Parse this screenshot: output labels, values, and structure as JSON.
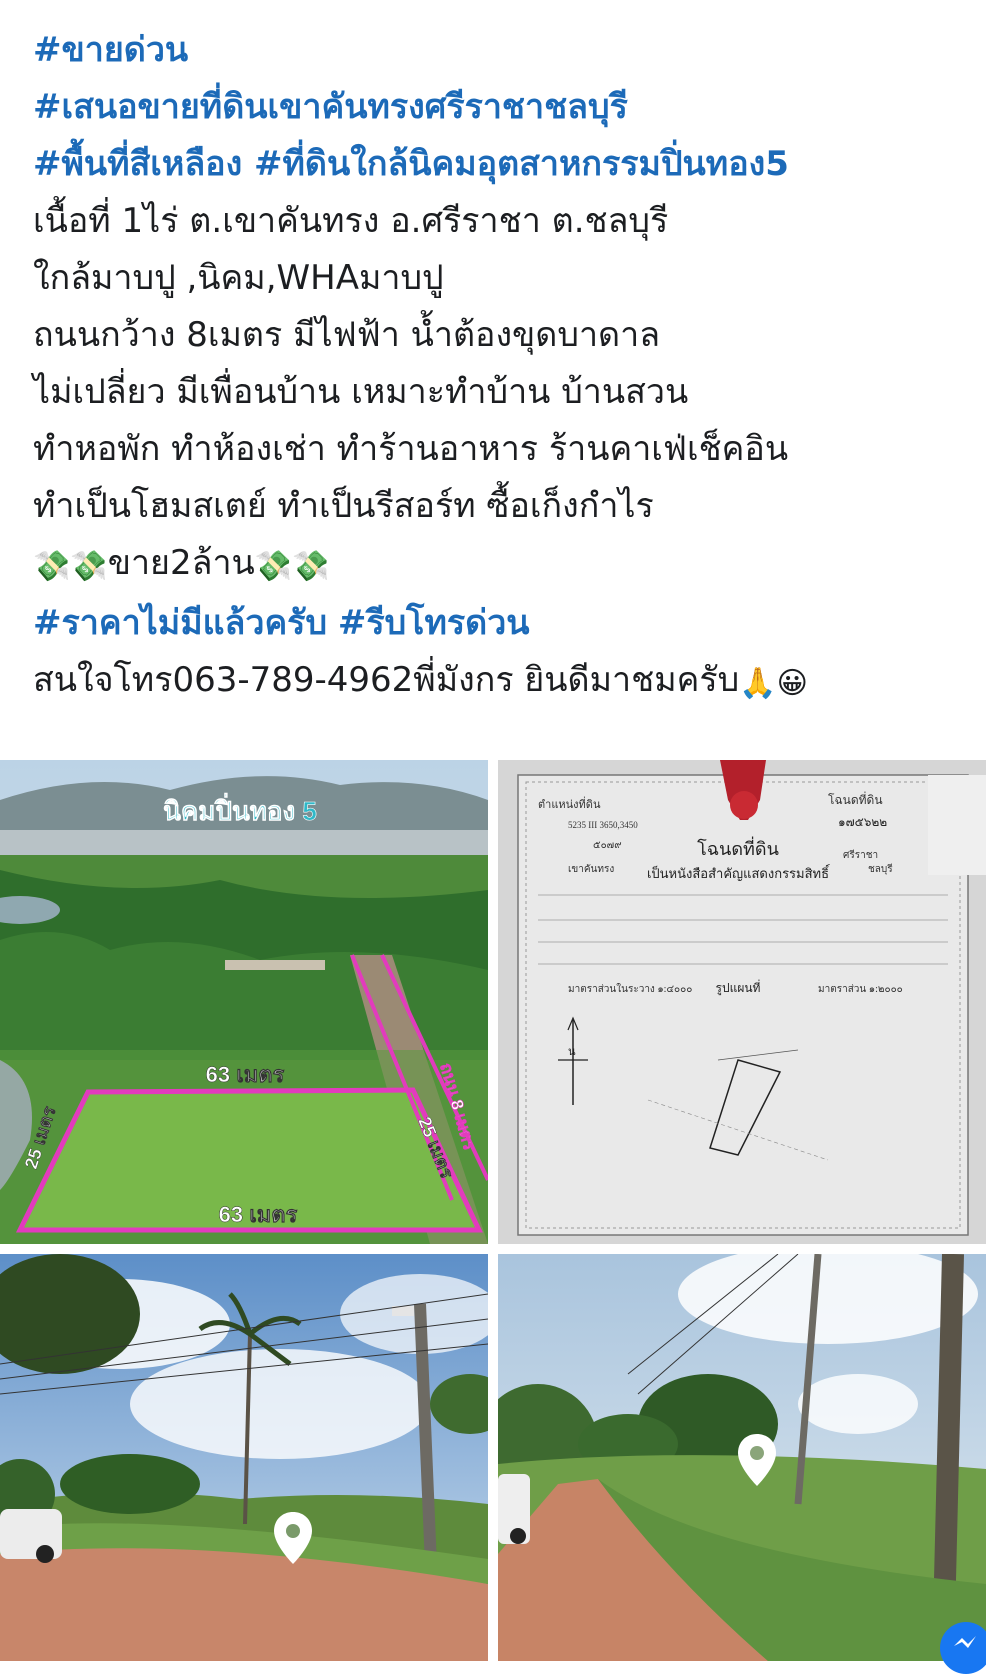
{
  "post": {
    "lines": [
      {
        "kind": "tag",
        "text": "#ขายด่วน"
      },
      {
        "kind": "tag",
        "text": "#เสนอขายที่ดินเขาคันทรงศรีราชาชลบุรี"
      },
      {
        "kind": "tag",
        "text": "#พื้นที่สีเหลือง #ที่ดินใกล้นิคมอุตสาหกรรมปิ่นทอง5"
      },
      {
        "kind": "text",
        "text": "เนื้อที่ 1ไร่ ต.เขาคันทรง อ.ศรีราชา ต.ชลบุรี"
      },
      {
        "kind": "text",
        "text": "ใกล้มาบปู ,นิคม,WHAมาบปู"
      },
      {
        "kind": "text",
        "text": "ถนนกว้าง 8เมตร มีไฟฟ้า น้ำต้องขุดบาดาล"
      },
      {
        "kind": "text",
        "text": "ไม่เปลี่ยว มีเพื่อนบ้าน เหมาะทำบ้าน บ้านสวน"
      },
      {
        "kind": "text",
        "text": "ทำหอพัก ทำห้องเช่า ทำร้านอาหาร ร้านคาเฟ่เช็คอิน"
      },
      {
        "kind": "text",
        "text": "ทำเป็นโฮมสเตย์ ทำเป็นรีสอร์ท ซื้อเก็งกำไร"
      }
    ],
    "price_line": {
      "emoji": "💸",
      "text": "ขาย2ล้าน"
    },
    "tags_line": {
      "tag1": "#ราคาไม่มีแล้วครับ",
      "tag2": "#รีบโทรด่วน"
    },
    "contact_line": {
      "text": "สนใจโทร063-789-4962พี่มังกร ยินดีมาชมครับ",
      "emoji1": "🙏",
      "emoji2": "😀"
    }
  },
  "photos": {
    "aerial": {
      "title": "นิคมปิ่นทอง 5",
      "top_width": "63 เมตร",
      "bottom_width": "63 เมตร",
      "left_length": "25 เมตร",
      "right_length": "25 เมตร",
      "road": "ถนน 8 เมตร"
    },
    "deed": {
      "heading_left": "ตำแหน่งที่ดิน",
      "heading_right": "โฉนดที่ดิน",
      "title": "โฉนดที่ดิน",
      "subtitle": "เป็นหนังสือสำคัญแสดงกรรมสิทธิ์",
      "map_label": "รูปแผนที่",
      "scale1": "มาตราส่วนในระวาง ๑:๔๐๐๐",
      "scale2": "มาตราส่วน ๑:๒๐๐๐",
      "sheet": "5235 III 3650,3450",
      "number": "๑๗๕๖๒๒",
      "district": "ศรีราชา",
      "province": "ชลบุรี",
      "subdistrict": "เขาคันทรง",
      "parcel": "๕๐๗๙",
      "north": "น"
    }
  },
  "colors": {
    "hashtag": "#1c6ab8",
    "text": "#1c1e21",
    "boundary": "#e23bbd",
    "accent": "#1877f2"
  },
  "icons": {
    "map_pin": "map-pin-icon",
    "messenger": "messenger-icon"
  }
}
